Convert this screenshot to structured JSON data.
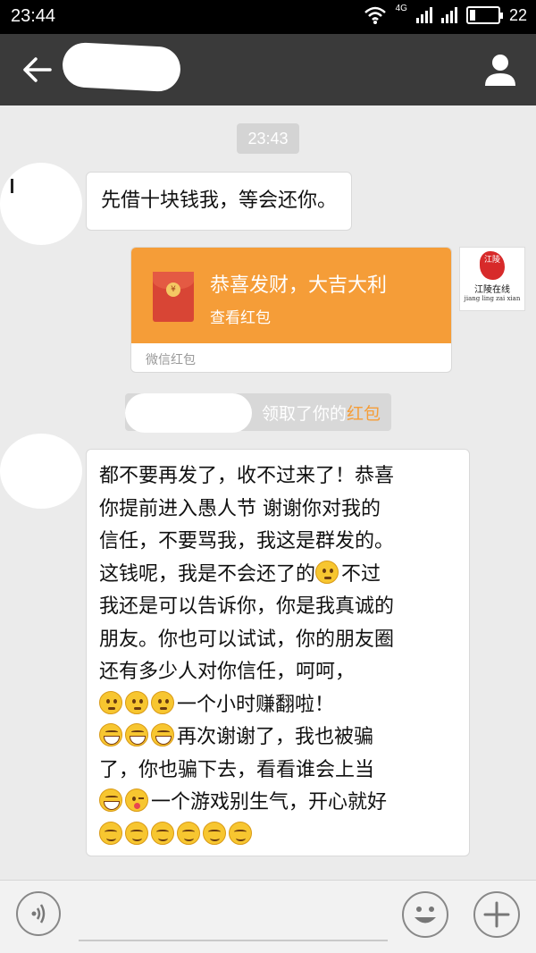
{
  "status_bar": {
    "time": "23:44",
    "network": "4G",
    "battery_level": "22"
  },
  "chat": {
    "time_separator": "23:43",
    "message_1": "先借十块钱我，等会还你。",
    "red_packet": {
      "title": "恭喜发财，大吉大利",
      "subtitle": "查看红包",
      "footer": "微信红包",
      "coin_symbol": "¥"
    },
    "contact_avatar": {
      "seal_text": "江陵",
      "brand": "江陵在线",
      "brand_sub": "jiang ling zai xian"
    },
    "notice": {
      "text": "领取了你的",
      "highlight": "红包"
    },
    "message_2": {
      "line_1": "都不要再发了，收不过来了！恭喜",
      "line_2": "你提前进入愚人节 谢谢你对我的",
      "line_3": "信任，不要骂我，我这是群发的。",
      "line_4": "这钱呢，我是不会还了的",
      "line_4b": "不过",
      "line_5": "我还是可以告诉你，你是我真诚的",
      "line_6": "朋友。你也可以试试，你的朋友圈",
      "line_7": "还有多少人对你信任，呵呵，",
      "line_8": "一个小时赚翻啦！",
      "line_9": "再次谢谢了，我也被骗",
      "line_10": "了，你也骗下去，看看谁会上当",
      "line_11": "一个游戏别生气，开心就好"
    }
  },
  "colors": {
    "nav_bg": "#3a3a3a",
    "red_packet_orange": "#f59d38",
    "chat_bg": "#ebebeb"
  }
}
